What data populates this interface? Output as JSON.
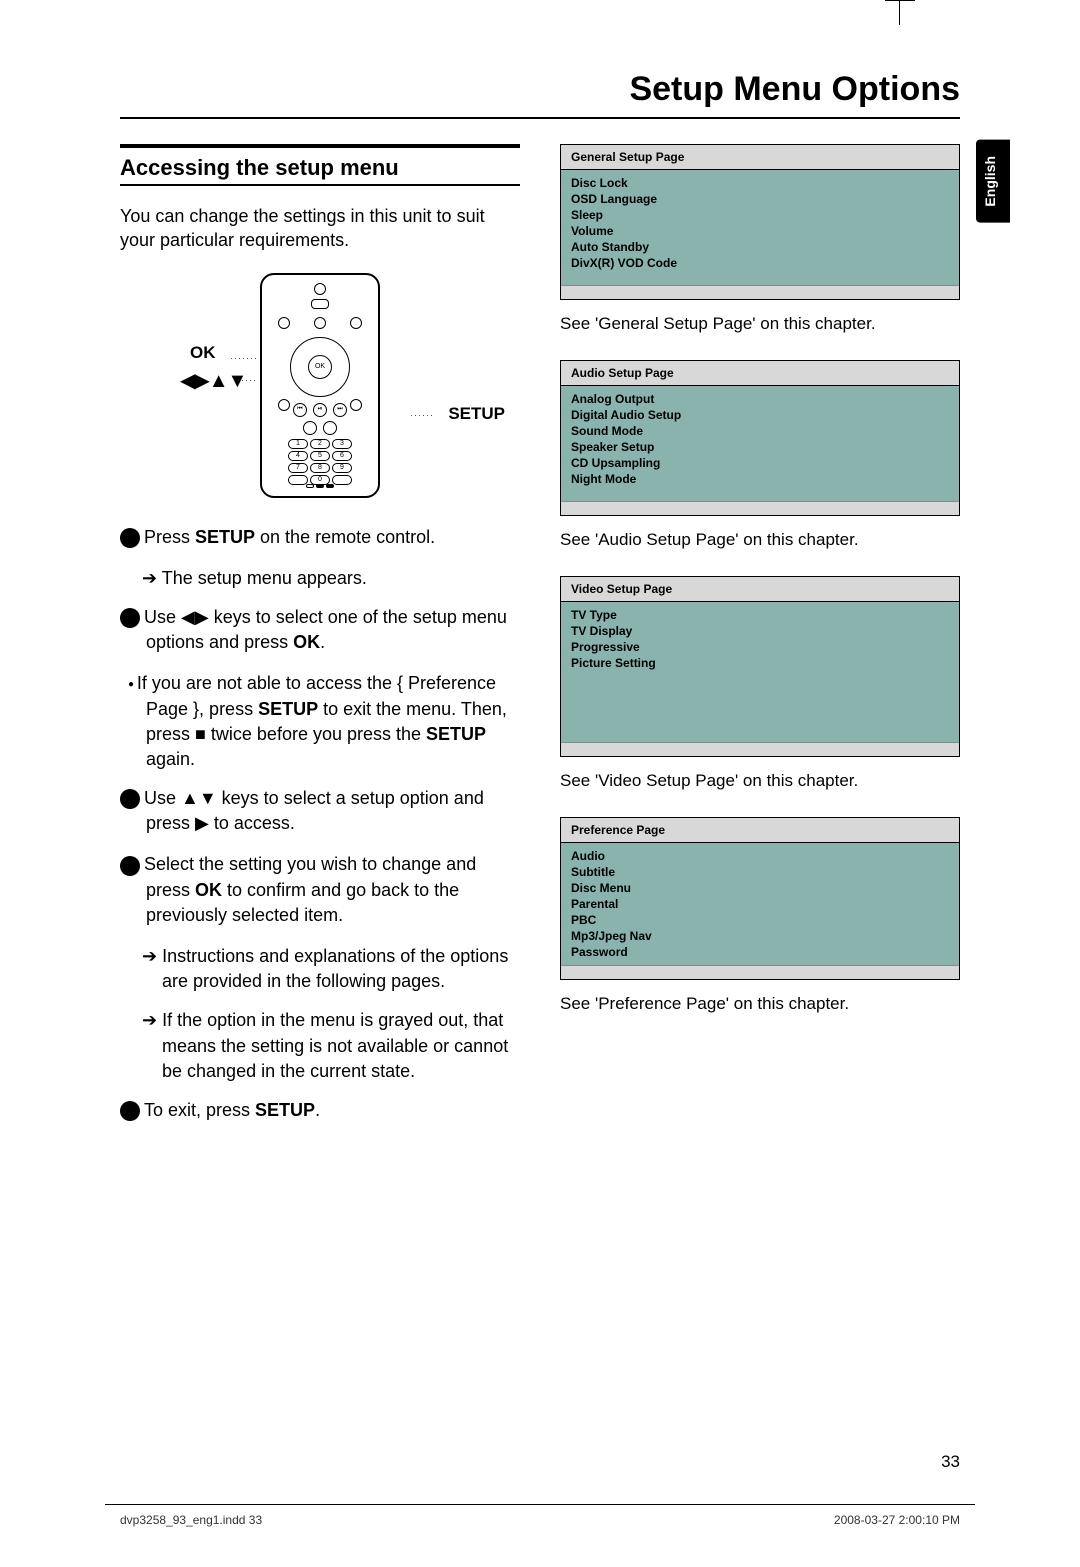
{
  "page_title": "Setup Menu Options",
  "language_tab": "English",
  "section_heading": "Accessing the setup menu",
  "intro": "You can change the settings in this unit to suit your particular requirements.",
  "remote_labels": {
    "ok": "OK",
    "arrows": "◀▶▲▼",
    "setup": "SETUP"
  },
  "steps": {
    "1_a": "Press ",
    "1_b": "SETUP",
    "1_c": " on the remote control.",
    "1_sub": "The setup menu appears.",
    "2_a": "Use ",
    "2_b": " keys to select one of the setup menu options and press ",
    "2_c": "OK",
    "2_d": ".",
    "bullet_a": "If you are not able to access the { Preference Page }, press ",
    "bullet_b": "SETUP",
    "bullet_c": " to exit the menu. Then, press ",
    "bullet_d": " twice before you press the ",
    "bullet_e": "SETUP",
    "bullet_f": " again.",
    "3_a": "Use ",
    "3_b": " keys to select a setup option and press ",
    "3_c": " to access.",
    "4_a": "Select the setting you wish to change and press ",
    "4_b": "OK",
    "4_c": " to confirm and go back to the previously selected item.",
    "4_sub1": "Instructions and explanations of the options are provided in the following pages.",
    "4_sub2": "If the option in the menu is grayed out, that means the setting is not available or cannot be changed in the current state.",
    "5_a": "To exit, press ",
    "5_b": "SETUP",
    "5_c": "."
  },
  "menus": [
    {
      "header": "General Setup Page",
      "items": [
        "Disc Lock",
        "OSD Language",
        "Sleep",
        "Volume",
        "Auto Standby",
        "DivX(R) VOD Code"
      ],
      "caption": "See 'General Setup Page' on this chapter."
    },
    {
      "header": "Audio Setup Page",
      "items": [
        "Analog Output",
        "Digital Audio Setup",
        "Sound Mode",
        "Speaker Setup",
        "CD Upsampling",
        "Night Mode"
      ],
      "caption": "See 'Audio Setup Page' on this chapter."
    },
    {
      "header": "Video Setup Page",
      "items": [
        "TV Type",
        "TV Display",
        "Progressive",
        "Picture Setting"
      ],
      "caption": "See 'Video Setup Page' on this chapter."
    },
    {
      "header": "Preference Page",
      "items": [
        "Audio",
        "Subtitle",
        "Disc Menu",
        "Parental",
        "PBC",
        "Mp3/Jpeg Nav",
        "Password"
      ],
      "caption": "See 'Preference Page' on this chapter."
    }
  ],
  "page_number": "33",
  "footer_left": "dvp3258_93_eng1.indd   33",
  "footer_right": "2008-03-27   2:00:10 PM"
}
